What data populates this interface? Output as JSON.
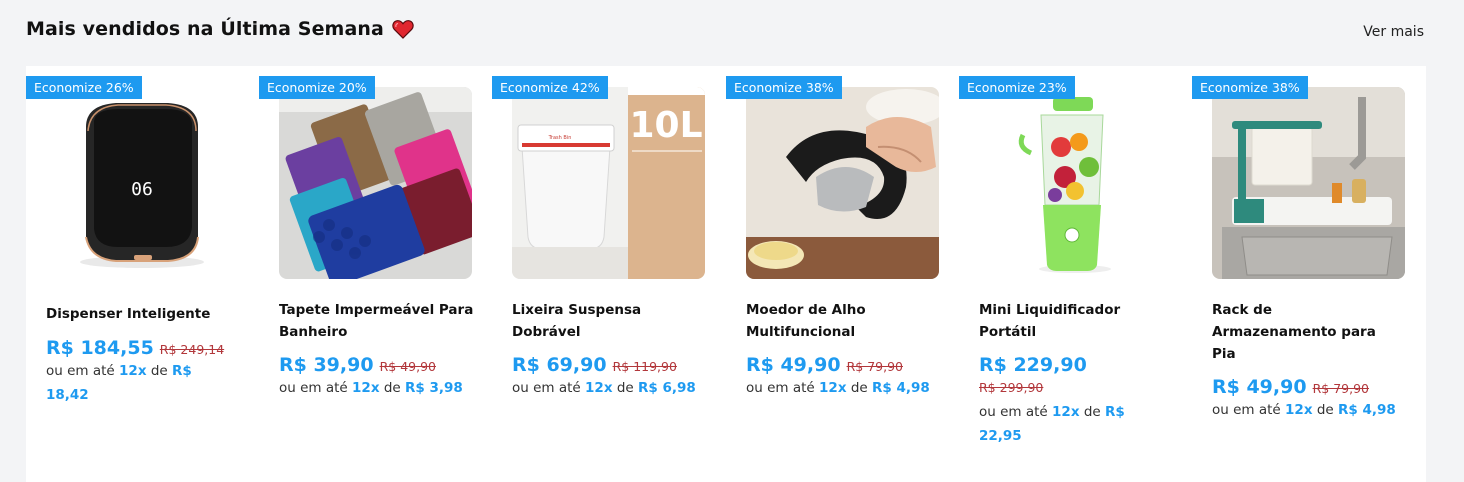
{
  "section": {
    "title": "Mais vendidos na Última Semana",
    "see_more": "Ver mais",
    "heart_color": "#e0262f",
    "accent": "#1e9af0"
  },
  "install_prefix": "ou em até",
  "install_mid": "de",
  "products": [
    {
      "badge": "Economize 26%",
      "name": "Dispenser Inteligente",
      "price": "R$ 184,55",
      "old_price": "R$ 249,14",
      "installments": "12x",
      "installment_value": "R$ 18,42",
      "image_icon": "smart-dispenser-image"
    },
    {
      "badge": "Economize 20%",
      "name": "Tapete Impermeável Para Banheiro",
      "price": "R$ 39,90",
      "old_price": "R$ 49,90",
      "installments": "12x",
      "installment_value": "R$ 3,98",
      "image_icon": "bath-mat-image"
    },
    {
      "badge": "Economize 42%",
      "name": "Lixeira Suspensa Dobrável",
      "price": "R$ 69,90",
      "old_price": "R$ 119,90",
      "installments": "12x",
      "installment_value": "R$ 6,98",
      "image_icon": "hanging-trash-bin-image",
      "image_text": "10L"
    },
    {
      "badge": "Economize 38%",
      "name": "Moedor de Alho Multifuncional",
      "price": "R$ 49,90",
      "old_price": "R$ 79,90",
      "installments": "12x",
      "installment_value": "R$ 4,98",
      "image_icon": "garlic-press-image"
    },
    {
      "badge": "Economize 23%",
      "name": "Mini Liquidificador Portátil",
      "price": "R$ 229,90",
      "old_price": "R$ 299,90",
      "installments": "12x",
      "installment_value": "R$ 22,95",
      "image_icon": "portable-blender-image"
    },
    {
      "badge": "Economize 38%",
      "name": "Rack de Armazenamento para Pia",
      "price": "R$ 49,90",
      "old_price": "R$ 79,90",
      "installments": "12x",
      "installment_value": "R$ 4,98",
      "image_icon": "sink-rack-image"
    }
  ]
}
